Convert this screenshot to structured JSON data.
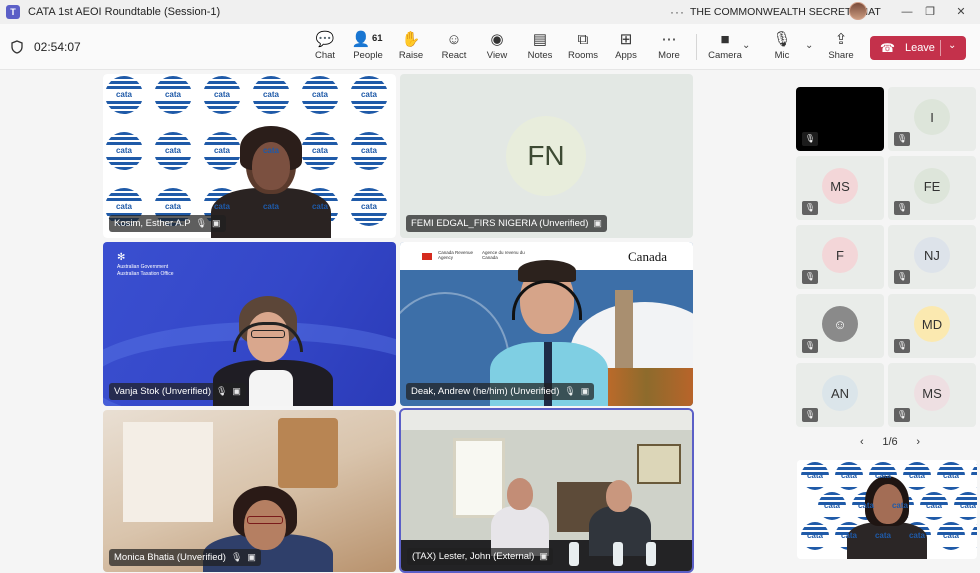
{
  "window": {
    "title": "CATA 1st AEOI Roundtable (Session-1)",
    "organization": "THE COMMONWEALTH SECRETARIAT",
    "app_logo": "T"
  },
  "toolbar": {
    "timer": "02:54:07",
    "participants_count": "61",
    "buttons": {
      "chat": "Chat",
      "people": "People",
      "raise": "Raise",
      "react": "React",
      "view": "View",
      "notes": "Notes",
      "rooms": "Rooms",
      "apps": "Apps",
      "more": "More",
      "camera": "Camera",
      "mic": "Mic",
      "share": "Share",
      "leave": "Leave"
    }
  },
  "tiles": {
    "t1": {
      "name": "Kosim, Esther A.P"
    },
    "t2": {
      "name": "FEMI EDGAL_FIRS NIGERIA (Unverified)",
      "initials": "FN"
    },
    "t3": {
      "name": "Vanja Stok (Unverified)",
      "banner_line1": "Australian Government",
      "banner_line2": "Australian Taxation Office"
    },
    "t4": {
      "name": "Deak, Andrew (he/him) (Unverified)",
      "agency_en": "Canada Revenue Agency",
      "agency_fr": "Agence du revenu du Canada",
      "wordmark": "Canada"
    },
    "t5": {
      "name": "Monica Bhatia (Unverified)"
    },
    "t6": {
      "name": "(TAX) Lester, John (External)"
    }
  },
  "globe_text": "cata",
  "side_tiles": [
    {
      "initials": ""
    },
    {
      "initials": "I"
    },
    {
      "initials": "MS"
    },
    {
      "initials": "FE"
    },
    {
      "initials": "F"
    },
    {
      "initials": "NJ"
    },
    {
      "initials": ""
    },
    {
      "initials": "MD"
    },
    {
      "initials": "AN"
    },
    {
      "initials": "MS"
    }
  ],
  "pager": {
    "label": "1/6"
  },
  "colors": {
    "accent": "#5b5fc7",
    "leave": "#c4314b",
    "cata_blue": "#1f5aa8",
    "ato_blue": "#3447c8"
  }
}
